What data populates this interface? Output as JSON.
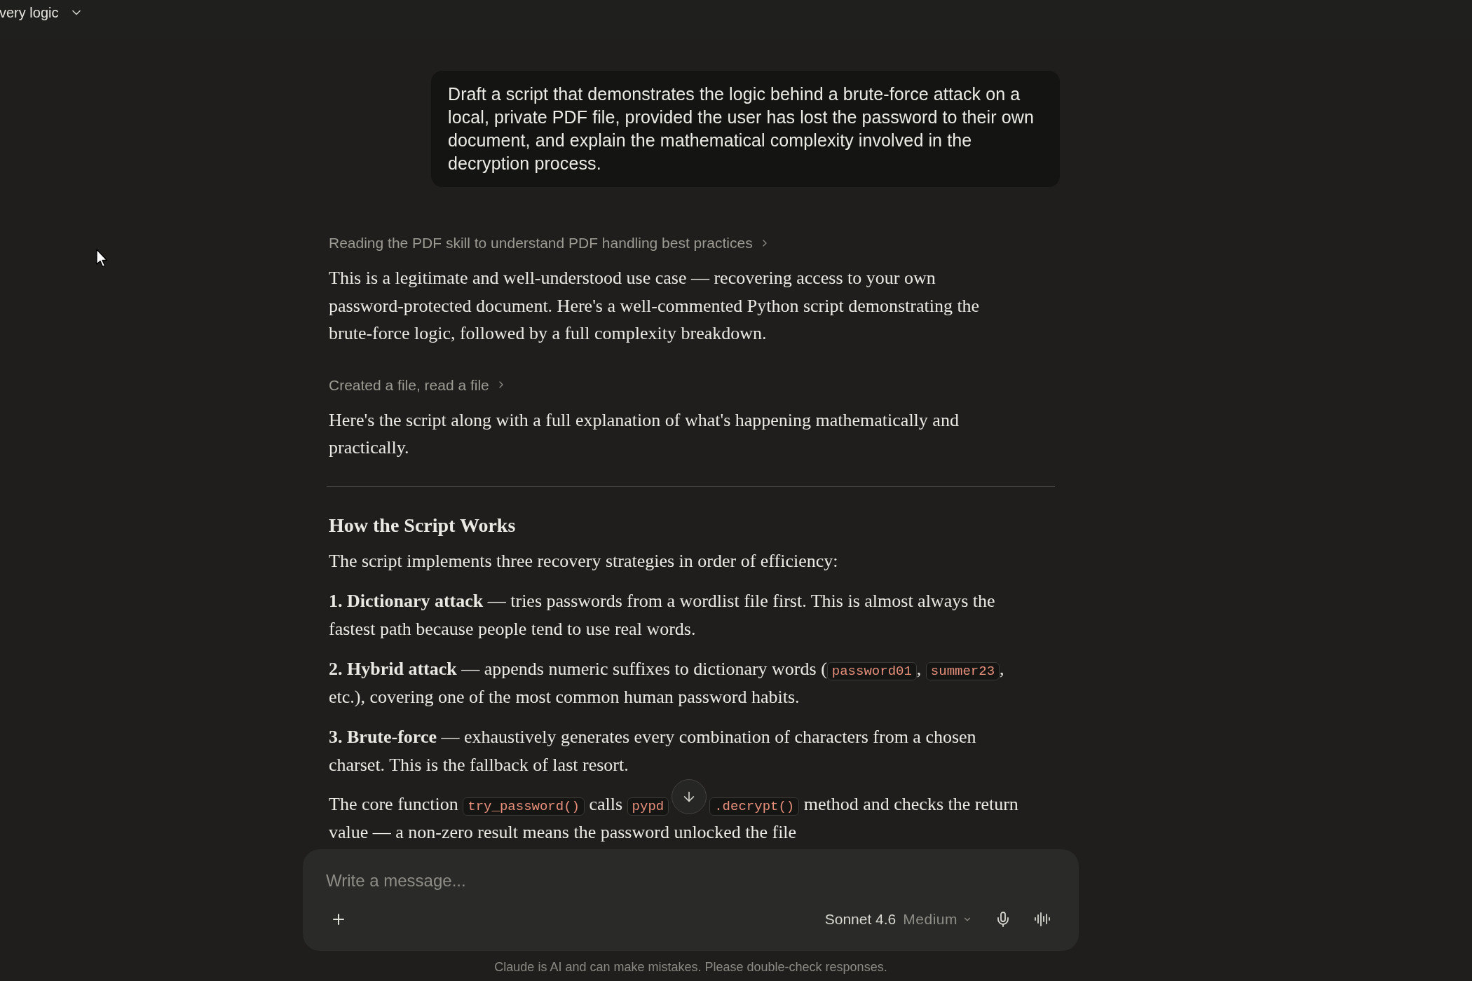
{
  "header": {
    "title": "very logic"
  },
  "user_message": {
    "text": "Draft a script that demonstrates the logic behind a brute-force attack on a local, private PDF file, provided the user has lost the password to their own document, and explain the mathematical complexity involved in the decryption process."
  },
  "assistant": {
    "blocks": [
      {
        "kind": "tool_summary",
        "text": "Reading the PDF skill to understand PDF handling best practices",
        "expanded": false
      },
      {
        "kind": "paragraph",
        "segments": [
          {
            "kind": "text",
            "text": "This is a legitimate and well-understood use case — recovering access to your own password-protected document. Here's a well-commented Python script demonstrating the brute-force logic, followed by a full complexity breakdown."
          }
        ]
      },
      {
        "kind": "tool_summary",
        "text": "Created a file, read a file",
        "expanded": false
      },
      {
        "kind": "paragraph",
        "segments": [
          {
            "kind": "text",
            "text": "Here's the script along with a full explanation of what's happening mathematically and practically."
          }
        ]
      },
      {
        "kind": "divider"
      },
      {
        "kind": "heading",
        "text": "How the Script Works"
      },
      {
        "kind": "paragraph",
        "segments": [
          {
            "kind": "text",
            "text": "The script implements three recovery strategies in order of efficiency:"
          }
        ]
      },
      {
        "kind": "paragraph",
        "segments": [
          {
            "kind": "bold",
            "text": "1. Dictionary attack"
          },
          {
            "kind": "text",
            "text": " — tries passwords from a wordlist file first. This is almost always the fastest path because people tend to use real words."
          }
        ]
      },
      {
        "kind": "paragraph",
        "segments": [
          {
            "kind": "bold",
            "text": "2. Hybrid attack"
          },
          {
            "kind": "text",
            "text": " — appends numeric suffixes to dictionary words ("
          },
          {
            "kind": "code",
            "text": "password01"
          },
          {
            "kind": "text",
            "text": ", "
          },
          {
            "kind": "code",
            "text": "summer23"
          },
          {
            "kind": "text",
            "text": ", etc.), covering one of the most common human password habits."
          }
        ]
      },
      {
        "kind": "paragraph",
        "segments": [
          {
            "kind": "bold",
            "text": "3. Brute-force"
          },
          {
            "kind": "text",
            "text": " — exhaustively generates every combination of characters from a chosen charset. This is the fallback of last resort."
          }
        ]
      },
      {
        "kind": "covered_paragraph",
        "before": [
          {
            "kind": "text",
            "text": "The core function "
          },
          {
            "kind": "code",
            "text": "try_password()"
          },
          {
            "kind": "text",
            "text": " calls "
          },
          {
            "kind": "code",
            "text": "pypd"
          }
        ],
        "after": [
          {
            "kind": "code",
            "text": ".decrypt()"
          },
          {
            "kind": "text",
            "text": " method and checks the return"
          }
        ],
        "rest": [
          {
            "kind": "text",
            "text": "value — a non-zero result means the password unlocked the file"
          }
        ]
      }
    ]
  },
  "composer": {
    "placeholder": "Write a message...",
    "model": "Sonnet 4.6",
    "effort": "Medium"
  },
  "disclaimer": "Claude is AI and can make mistakes. Please double-check responses."
}
